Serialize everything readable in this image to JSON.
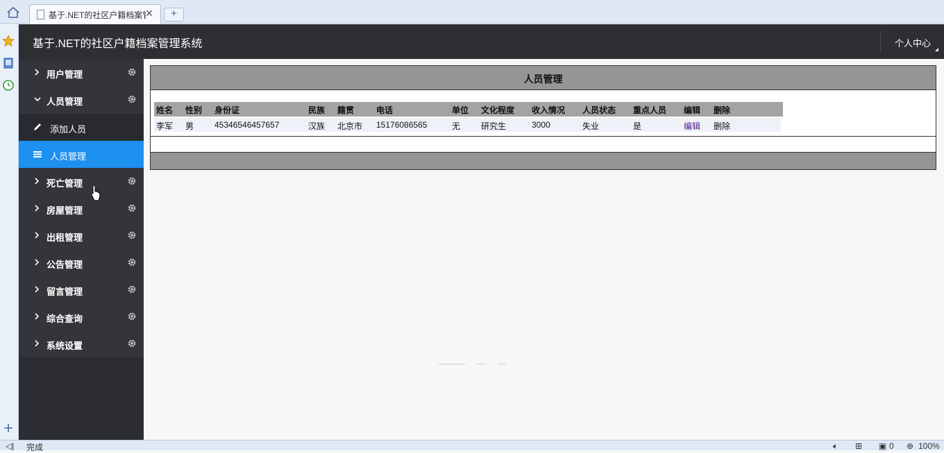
{
  "browser": {
    "tab_title": "基于.NET的社区户籍档案管理系统",
    "tab_close": "✕",
    "new_tab": "+",
    "status_text": "完成",
    "status_count": "0",
    "zoom": "100%"
  },
  "header": {
    "title": "基于.NET的社区户籍档案管理系统",
    "user_center": "个人中心"
  },
  "sidebar": {
    "groups": [
      {
        "label": "用户管理",
        "expanded": false
      },
      {
        "label": "人员管理",
        "expanded": true
      },
      {
        "label": "死亡管理",
        "expanded": false
      },
      {
        "label": "房屋管理",
        "expanded": false
      },
      {
        "label": "出租管理",
        "expanded": false
      },
      {
        "label": "公告管理",
        "expanded": false
      },
      {
        "label": "留言管理",
        "expanded": false
      },
      {
        "label": "综合查询",
        "expanded": false
      },
      {
        "label": "系统设置",
        "expanded": false
      }
    ],
    "sub_items": [
      {
        "label": "添加人员",
        "icon": "pencil-icon",
        "active": false
      },
      {
        "label": "人员管理",
        "icon": "list-icon",
        "active": true
      }
    ]
  },
  "panel": {
    "title": "人员管理",
    "columns": [
      "姓名",
      "性别",
      "身份证",
      "民族",
      "籍贯",
      "电话",
      "单位",
      "文化程度",
      "收入情况",
      "人员状态",
      "重点人员",
      "编辑",
      "删除"
    ],
    "rows": [
      [
        "李军",
        "男",
        "45346546457657",
        "汉族",
        "北京市",
        "15176086565",
        "无",
        "研究生",
        "3000",
        "失业",
        "是",
        "编辑",
        "删除"
      ]
    ]
  },
  "colors": {
    "header_bg": "#2e2f33",
    "sidebar_bg": "#34353b",
    "active_item": "#1e90f0",
    "panel_head": "#959595"
  }
}
